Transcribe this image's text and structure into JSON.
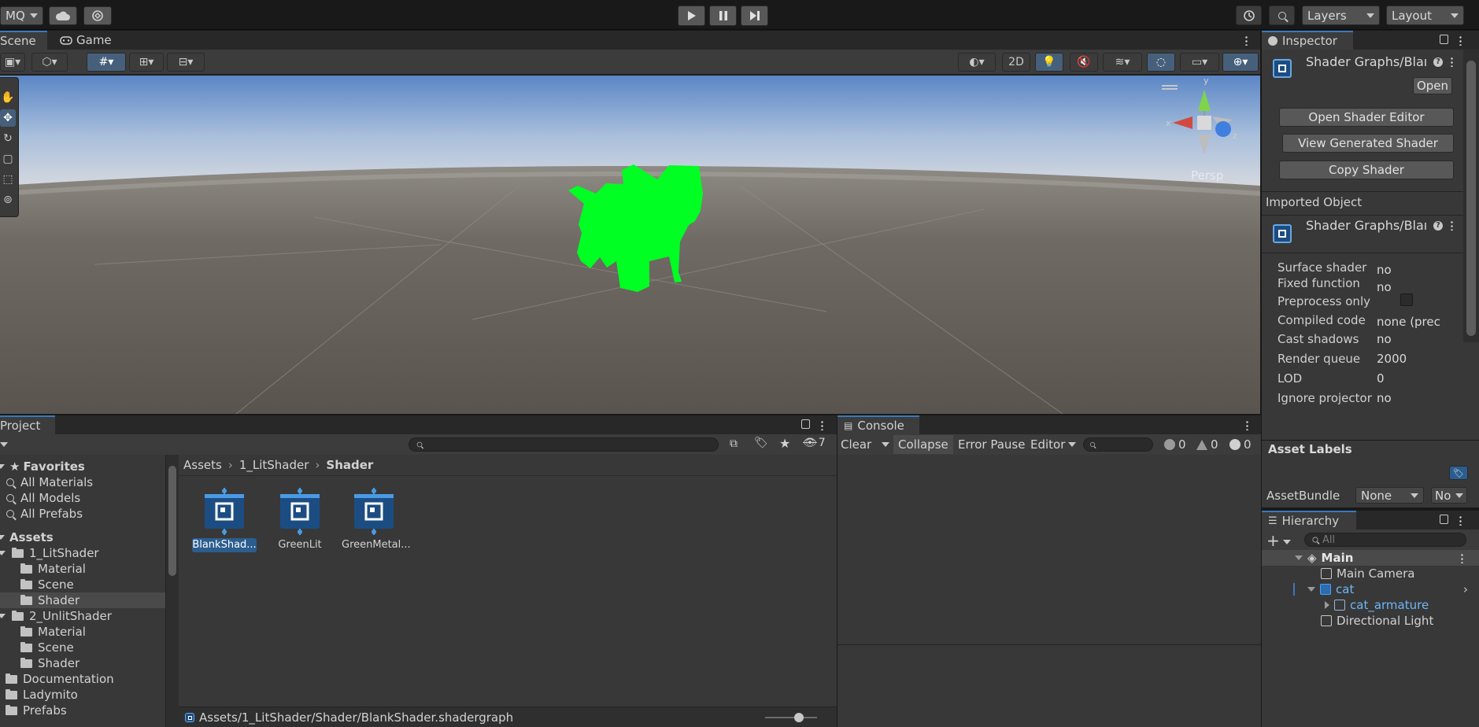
{
  "toolbar": {
    "account_label": "MQ",
    "layers_label": "Layers",
    "layout_label": "Layout",
    "play_icon": "play-icon",
    "pause_icon": "pause-icon",
    "step_icon": "step-icon"
  },
  "scene": {
    "tabs": [
      "Scene",
      "Game"
    ],
    "mode_2d": "2D",
    "persp_label": "Persp",
    "gizmo_axes": {
      "x": "x",
      "y": "y",
      "z": "z"
    },
    "cat_color": "#00ff22"
  },
  "inspector": {
    "tab": "Inspector",
    "title": "Shader Graphs/Blaı",
    "open_button": "Open",
    "buttons": [
      "Open Shader Editor",
      "View Generated Shader",
      "Copy Shader"
    ],
    "imported_object_header": "Imported Object",
    "imported_title": "Shader Graphs/Blaı",
    "properties": [
      {
        "label": "Surface shader",
        "value": "no"
      },
      {
        "label": "Fixed function",
        "value": "no"
      },
      {
        "label": "Preprocess only",
        "value": ""
      },
      {
        "label": "Compiled code",
        "value": "none (prec"
      },
      {
        "label": "Cast shadows",
        "value": "no"
      },
      {
        "label": "Render queue",
        "value": "2000"
      },
      {
        "label": "LOD",
        "value": "0"
      },
      {
        "label": "Ignore projector",
        "value": "no"
      }
    ],
    "asset_labels": "Asset Labels",
    "asset_bundle_label": "AssetBundle",
    "asset_bundle_value": "None",
    "asset_bundle_variant": "No"
  },
  "hierarchy": {
    "tab": "Hierarchy",
    "search_placeholder": "All",
    "items": [
      {
        "label": "Main",
        "depth": 0
      },
      {
        "label": "Main Camera",
        "depth": 1
      },
      {
        "label": "cat",
        "depth": 1
      },
      {
        "label": "cat_armature",
        "depth": 2
      },
      {
        "label": "Directional Light",
        "depth": 1
      }
    ]
  },
  "project": {
    "tab": "Project",
    "hidden_count": "7",
    "favorites_header": "Favorites",
    "favorites": [
      "All Materials",
      "All Models",
      "All Prefabs"
    ],
    "assets_header": "Assets",
    "tree": [
      {
        "label": "1_LitShader",
        "depth": 1
      },
      {
        "label": "Material",
        "depth": 2
      },
      {
        "label": "Scene",
        "depth": 2
      },
      {
        "label": "Shader",
        "depth": 2
      },
      {
        "label": "2_UnlitShader",
        "depth": 1
      },
      {
        "label": "Material",
        "depth": 2
      },
      {
        "label": "Scene",
        "depth": 2
      },
      {
        "label": "Shader",
        "depth": 2
      },
      {
        "label": "Documentation",
        "depth": 1
      },
      {
        "label": "Ladymito",
        "depth": 1
      },
      {
        "label": "Prefabs",
        "depth": 1
      }
    ],
    "breadcrumb": [
      "Assets",
      "1_LitShader",
      "Shader"
    ],
    "files": [
      "BlankShad...",
      "GreenLit",
      "GreenMetal..."
    ],
    "status_path": "Assets/1_LitShader/Shader/BlankShader.shadergraph"
  },
  "console": {
    "tab": "Console",
    "clear": "Clear",
    "collapse": "Collapse",
    "error_pause": "Error Pause",
    "editor": "Editor",
    "counts": {
      "info": "0",
      "warning": "0",
      "error": "0"
    }
  }
}
